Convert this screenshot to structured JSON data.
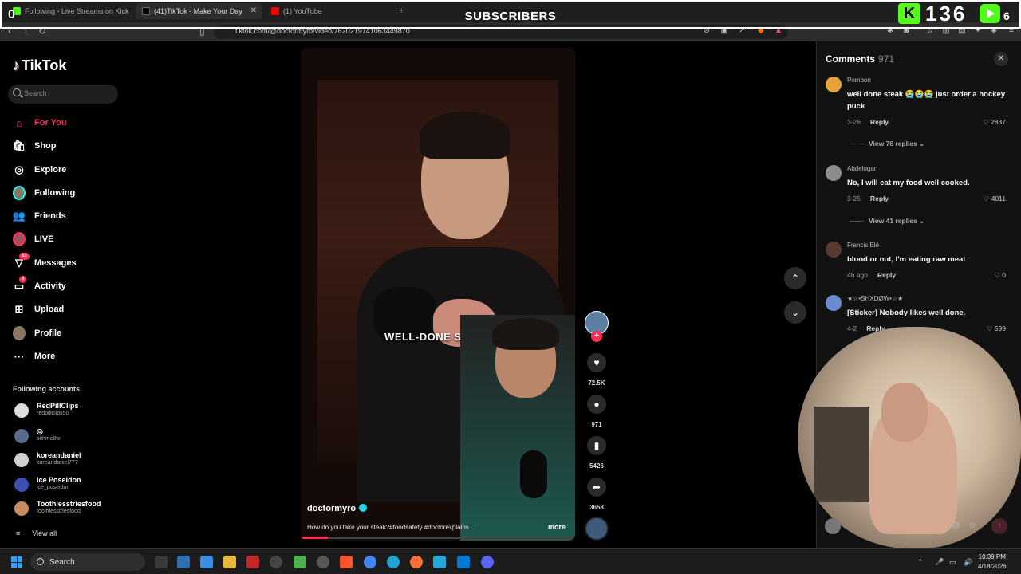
{
  "browser": {
    "tabs": [
      {
        "label": "Following - Live Streams on Kick"
      },
      {
        "label": "(41)TikTok - Make Your Day"
      },
      {
        "label": "(1) YouTube"
      }
    ],
    "new_tab": "+",
    "url": "tiktok.com/@doctormyro/video/7620219741063449870"
  },
  "overlay": {
    "title": "SUBSCRIBERS",
    "left_value": "0",
    "kick_letter": "K",
    "count": "136",
    "right_value": "6"
  },
  "sidebar": {
    "logo": "TikTok",
    "search_placeholder": "Search",
    "items": [
      {
        "label": "For You",
        "icon": "home-icon"
      },
      {
        "label": "Shop",
        "icon": "shop-icon"
      },
      {
        "label": "Explore",
        "icon": "compass-icon"
      },
      {
        "label": "Following",
        "icon": "avatar-icon"
      },
      {
        "label": "Friends",
        "icon": "friends-icon"
      },
      {
        "label": "LIVE",
        "icon": "live-icon"
      },
      {
        "label": "Messages",
        "icon": "messages-icon",
        "badge": "33"
      },
      {
        "label": "Activity",
        "icon": "activity-icon",
        "badge": "8"
      },
      {
        "label": "Upload",
        "icon": "upload-icon"
      },
      {
        "label": "Profile",
        "icon": "profile-avatar-icon"
      },
      {
        "label": "More",
        "icon": "more-icon"
      }
    ],
    "following_title": "Following accounts",
    "accounts": [
      {
        "name": "RedPillClips",
        "handle": "redpillclips50"
      },
      {
        "name": "◎",
        "handle": "sithme0w"
      },
      {
        "name": "koreandaniel",
        "handle": "koreandaniel777"
      },
      {
        "name": "Ice Poseidon",
        "handle": "ice_poseidon"
      },
      {
        "name": "Toothlesstriesfood",
        "handle": "toothlesstriesfood"
      }
    ],
    "view_all": "View all"
  },
  "video": {
    "overlay_text": "WELL-DONE STEAK",
    "author": "doctormyro",
    "caption": "How do you take your steak?#foodsafety #doctorexplains ...",
    "more": "more",
    "progress": 0.1
  },
  "actions": {
    "likes": "72.5K",
    "comments": "971",
    "saves": "5426",
    "shares": "3653"
  },
  "comments": {
    "title": "Comments",
    "count": "971",
    "reply_label": "Reply",
    "items": [
      {
        "user": "Pombon",
        "text": "well done steak 😭😭😭 just order a hockey puck",
        "date": "3-26",
        "likes": "2837",
        "replies": "View 76 replies"
      },
      {
        "user": "Abdelogan",
        "text": "No, I will eat my food well cooked.",
        "date": "3-25",
        "likes": "4011",
        "replies": "View 41 replies"
      },
      {
        "user": "Francis Elé",
        "text": "blood or not, I'm eating raw meat",
        "date": "4h ago",
        "likes": "0",
        "replies": ""
      },
      {
        "user": "★☆•SHXDØW•☆★",
        "text": "[Sticker] Nobody likes well done.",
        "date": "4-2",
        "likes": "599",
        "replies": ""
      }
    ]
  },
  "taskbar": {
    "search": "Search",
    "time": "10:39 PM",
    "date": "4/18/2026"
  },
  "colors": {
    "accent": "#fe2c55",
    "kick_green": "#53fc18",
    "panel": "#121212"
  }
}
